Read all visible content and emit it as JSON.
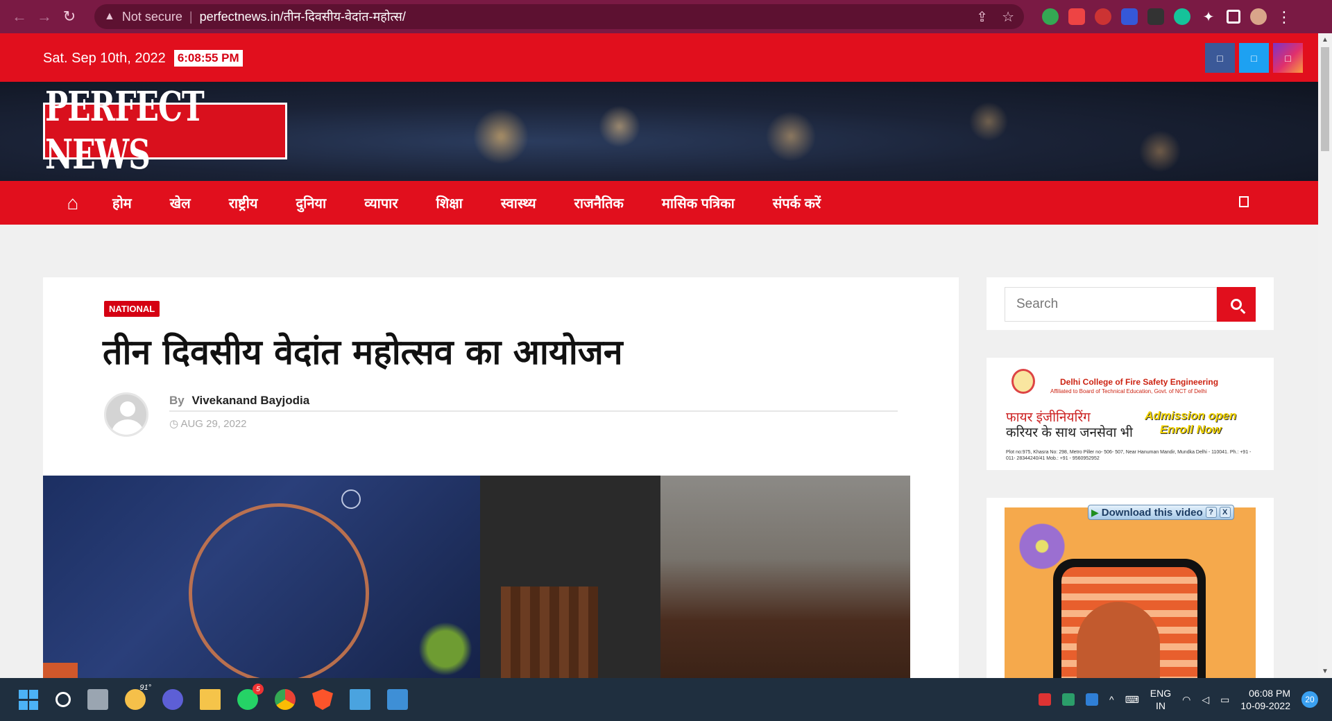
{
  "browser": {
    "security_label": "Not secure",
    "url": "perfectnews.in/तीन-दिवसीय-वेदांत-महोत्स/"
  },
  "topbar": {
    "date": "Sat. Sep 10th, 2022",
    "clock": "6:08:55 PM",
    "social": [
      "facebook-icon",
      "twitter-icon",
      "instagram-icon"
    ],
    "colors": {
      "accent": "#e10f1d",
      "facebook": "#3b5998",
      "twitter": "#1da1f2"
    }
  },
  "logo": {
    "text": "PERFECT NEWS"
  },
  "nav": {
    "items": [
      "होम",
      "खेल",
      "राष्ट्रीय",
      "दुनिया",
      "व्यापार",
      "शिक्षा",
      "स्वास्थ्य",
      "राजनैतिक",
      "मासिक पत्रिका",
      "संपर्क करें"
    ]
  },
  "article": {
    "category": "NATIONAL",
    "title": "तीन दिवसीय वेदांत महोत्सव का आयोजन",
    "by_label": "By",
    "author": "Vivekanand Bayjodia",
    "date": "AUG 29, 2022"
  },
  "sidebar": {
    "search_placeholder": "Search",
    "ad1": {
      "college": "Delhi College of Fire Safety Engineering",
      "affiliation": "Affiliated to Board of Technical Education, Govt. of NCT of Delhi",
      "headline1": "फायर इंजीनियरिंग",
      "headline2": "करियर के साथ जनसेवा भी",
      "admission": "Admission open",
      "enroll": "Enroll Now",
      "address": "Plot no:975, Khasra No: 298, Metro Piller no- 506- 507, Near Hanuman Mandir, Mundka Delhi - 110041. Ph.: +91 - 011- 28344240/41 Mob.: +91 - 9560952952"
    },
    "ad2": {
      "download_label": "Download this video",
      "help": "?",
      "close": "X"
    }
  },
  "taskbar": {
    "temperature": "91°",
    "whatsapp_badge": "5",
    "lang1": "ENG",
    "lang2": "IN",
    "time": "06:08 PM",
    "date": "10-09-2022",
    "notifications": "20"
  }
}
